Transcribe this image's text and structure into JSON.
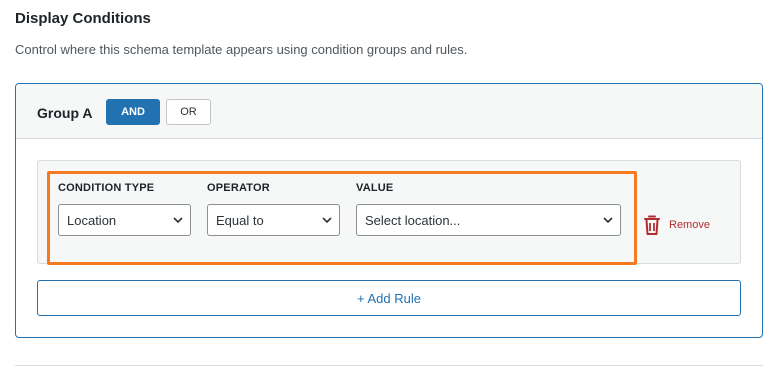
{
  "section": {
    "title": "Display Conditions",
    "description": "Control where this schema template appears using condition groups and rules."
  },
  "group": {
    "label": "Group A",
    "logic_options": [
      "AND",
      "OR"
    ],
    "active_logic": "AND",
    "rules": [
      {
        "condition_type_label": "CONDITION TYPE",
        "condition_type_value": "Location",
        "operator_label": "OPERATOR",
        "operator_value": "Equal to",
        "value_label": "VALUE",
        "value_placeholder": "Select location...",
        "remove_label": "Remove",
        "remove_icon": "trash-icon"
      }
    ],
    "add_rule_label": "+ Add Rule"
  },
  "colors": {
    "accent": "#2271b1",
    "highlight": "#f47a1f",
    "danger": "#b32d2e"
  }
}
